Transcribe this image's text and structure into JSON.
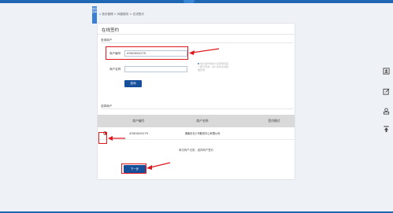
{
  "header": {
    "tab_label": "",
    "side_toggle_label": "收起菜单"
  },
  "breadcrumb": {
    "home_icon": "home-icon",
    "text": "首页管理 > 网银服务 > 在线签约"
  },
  "panel": {
    "title": "在线签约"
  },
  "query_section": {
    "label": "查询商户",
    "merchant_no_label": "商户编号",
    "merchant_no_value": "4300000175",
    "merchant_name_label": "商户名称",
    "merchant_name_value": "",
    "hint": "商户编号或商户名称填写其一即可查询，商户名称支持模糊查询",
    "query_button": "查询"
  },
  "select_section": {
    "label": "选择商户",
    "columns": [
      "商户编号",
      "商户名称",
      "签约模式"
    ],
    "rows": [
      {
        "selected": true,
        "merchant_no": "4300000175",
        "merchant_name": "湖南省长沙市服务中心有限公司",
        "sign_mode": ""
      }
    ],
    "note": "单击商户记录，选择商户签约",
    "next_button": "下一步"
  },
  "right_toolbar": {
    "icons": [
      "contact-card-icon",
      "edit-icon",
      "user-stamp-icon",
      "pin-top-icon"
    ]
  },
  "colors": {
    "top_bar": "#1f66b3",
    "primary_button": "#17509a",
    "annotation_red": "#e0161d",
    "table_header": "#d9d9d9"
  }
}
